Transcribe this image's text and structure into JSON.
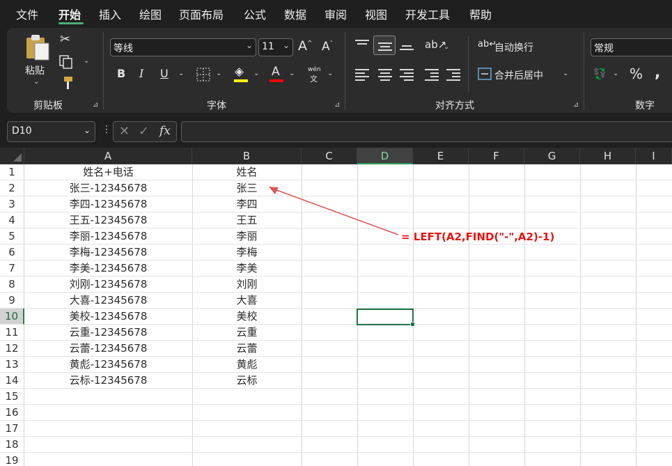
{
  "menu": {
    "file": "文件",
    "home": "开始",
    "insert": "插入",
    "draw": "绘图",
    "layout": "页面布局",
    "formulas": "公式",
    "data": "数据",
    "review": "审阅",
    "view": "视图",
    "developer": "开发工具",
    "help": "帮助"
  },
  "ribbon": {
    "clipboard": {
      "paste_label": "粘贴",
      "group_label": "剪贴板"
    },
    "font": {
      "font_name": "等线",
      "font_size": "11",
      "group_label": "字体",
      "phonetic_top": "wén",
      "phonetic_bottom": "文"
    },
    "alignment": {
      "wrap_label": "自动换行",
      "merge_label": "合并后居中",
      "group_label": "对齐方式"
    },
    "number": {
      "format": "常规",
      "group_label": "数字"
    },
    "colors": {
      "highlight": "#ffff00",
      "font_color": "#ff0000"
    }
  },
  "formula_bar": {
    "name_box": "D10",
    "formula": ""
  },
  "sheet": {
    "columns": [
      "A",
      "B",
      "C",
      "D",
      "E",
      "F",
      "G",
      "H",
      "I"
    ],
    "selected_column": "D",
    "rows": [
      "1",
      "2",
      "3",
      "4",
      "5",
      "6",
      "7",
      "8",
      "9",
      "10",
      "11",
      "12",
      "13",
      "14",
      "15",
      "16",
      "17",
      "18",
      "19"
    ],
    "selected_row": "10",
    "col_a": [
      "姓名+电话",
      "张三-12345678",
      "李四-12345678",
      "王五-12345678",
      "李丽-12345678",
      "李梅-12345678",
      "李美-12345678",
      "刘刚-12345678",
      "大喜-12345678",
      "美校-12345678",
      "云重-12345678",
      "云蕾-12345678",
      "黄彪-12345678",
      "云标-12345678"
    ],
    "col_b": [
      "姓名",
      "张三",
      "李四",
      "王五",
      "李丽",
      "李梅",
      "李美",
      "刘刚",
      "大喜",
      "美校",
      "云重",
      "云蕾",
      "黄彪",
      "云标"
    ]
  },
  "annotation": {
    "text": "=  LEFT(A2,FIND(\"-\",A2)-1)",
    "color": "#ee1111"
  }
}
